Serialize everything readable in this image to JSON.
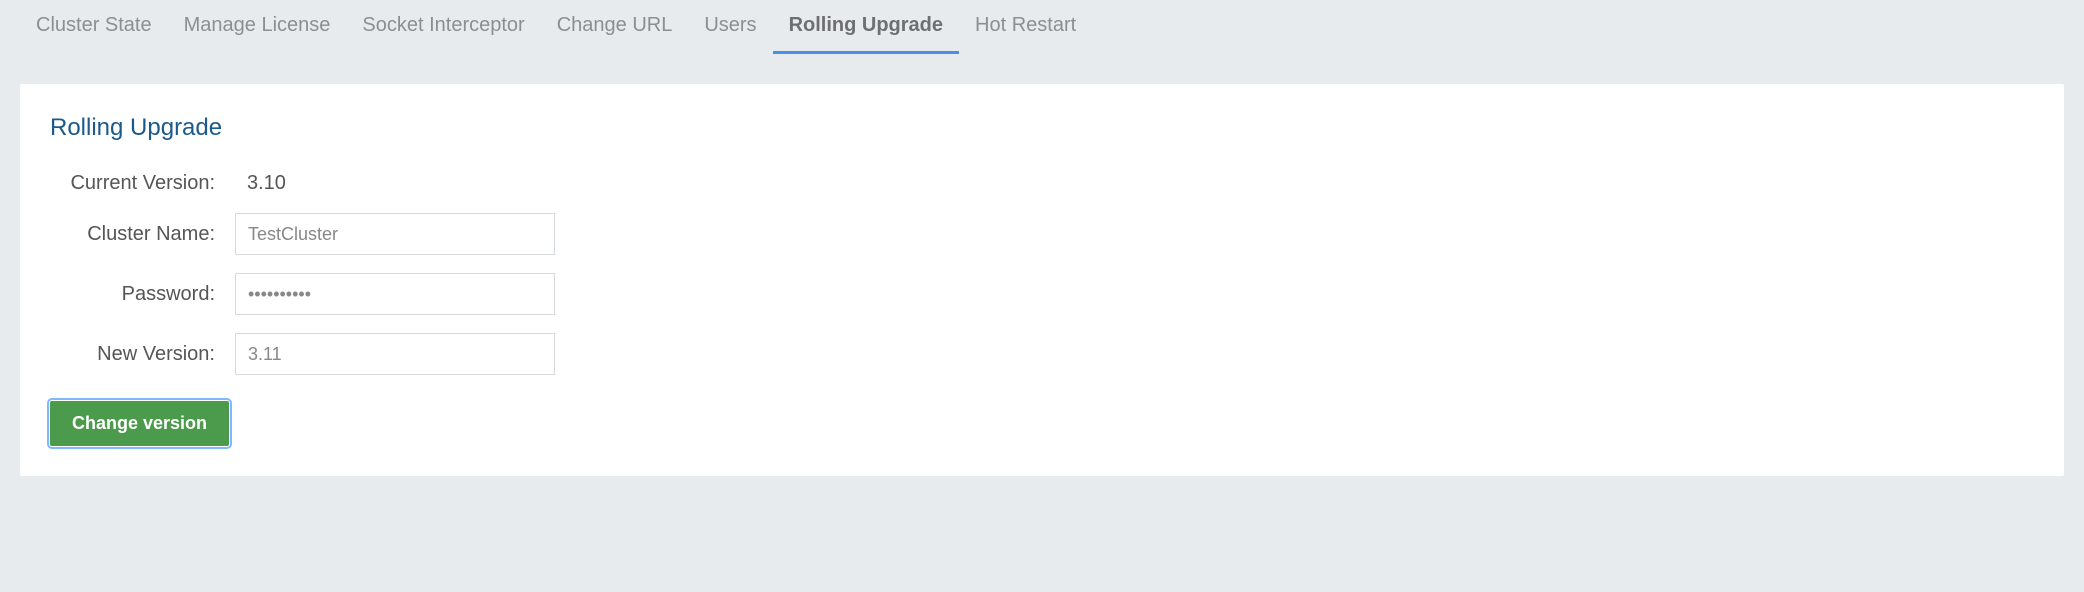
{
  "tabs": [
    {
      "label": "Cluster State",
      "active": false
    },
    {
      "label": "Manage License",
      "active": false
    },
    {
      "label": "Socket Interceptor",
      "active": false
    },
    {
      "label": "Change URL",
      "active": false
    },
    {
      "label": "Users",
      "active": false
    },
    {
      "label": "Rolling Upgrade",
      "active": true
    },
    {
      "label": "Hot Restart",
      "active": false
    }
  ],
  "panel": {
    "title": "Rolling Upgrade",
    "current_version_label": "Current Version:",
    "current_version_value": "3.10",
    "cluster_name_label": "Cluster Name:",
    "cluster_name_value": "TestCluster",
    "password_label": "Password:",
    "password_value": "••••••••••",
    "new_version_label": "New Version:",
    "new_version_value": "3.11",
    "button_label": "Change version"
  }
}
